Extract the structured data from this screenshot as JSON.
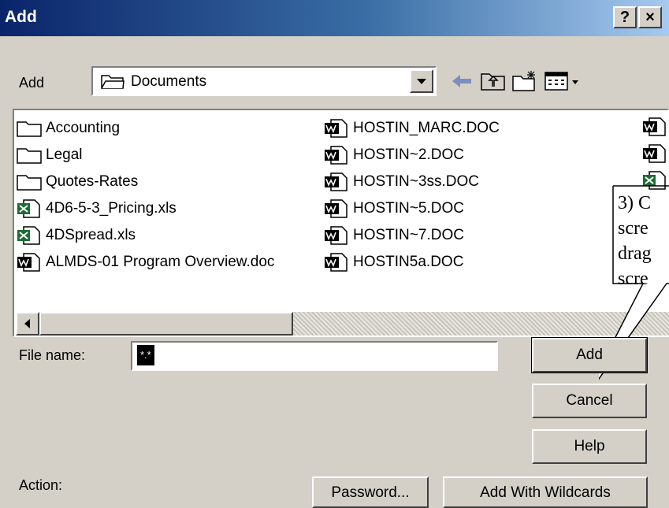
{
  "window": {
    "title": "Add",
    "help_button": "?",
    "close_button": "×"
  },
  "look_in": {
    "label": "Add",
    "value": "Documents"
  },
  "files": [
    {
      "name": "Accounting",
      "type": "folder"
    },
    {
      "name": "Legal",
      "type": "folder"
    },
    {
      "name": "Quotes-Rates",
      "type": "folder"
    },
    {
      "name": "4D6-5-3_Pricing.xls",
      "type": "xls"
    },
    {
      "name": "4DSpread.xls",
      "type": "xls"
    },
    {
      "name": "ALMDS-01 Program Overview.doc",
      "type": "doc"
    },
    {
      "name": "HOSTIN_MARC.DOC",
      "type": "doc"
    },
    {
      "name": "HOSTIN~2.DOC",
      "type": "doc"
    },
    {
      "name": "HOSTIN~3ss.DOC",
      "type": "doc"
    },
    {
      "name": "HOSTIN~5.DOC",
      "type": "doc"
    },
    {
      "name": "HOSTIN~7.DOC",
      "type": "doc"
    },
    {
      "name": "HOSTIN5a.DOC",
      "type": "doc"
    }
  ],
  "file_name": {
    "label": "File name:",
    "value": "*.*"
  },
  "buttons": {
    "add": "Add",
    "cancel": "Cancel",
    "help": "Help",
    "password": "Password...",
    "add_wildcards": "Add With Wildcards"
  },
  "action": {
    "label": "Action:"
  },
  "callout": {
    "lines": [
      "3) C",
      "scre",
      "drag",
      "scre"
    ]
  }
}
